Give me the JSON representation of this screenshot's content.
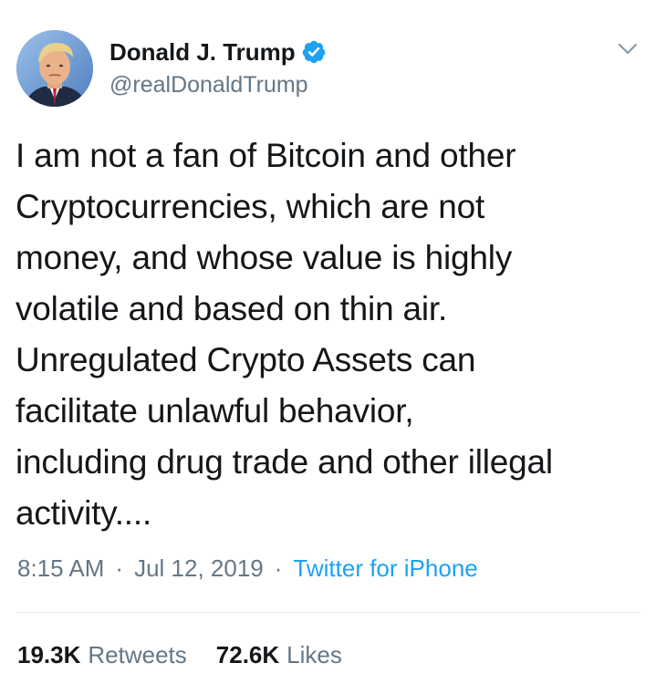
{
  "author": {
    "display_name": "Donald J. Trump",
    "handle": "@realDonaldTrump",
    "verified": true,
    "avatar_icon": "profile-photo"
  },
  "tweet": {
    "text": "I am not a fan of Bitcoin and other\nCryptocurrencies, which are not\nmoney, and whose value is highly\nvolatile and based on thin air.\nUnregulated Crypto Assets can\nfacilitate unlawful behavior,\nincluding drug trade and other illegal\nactivity....",
    "time": "8:15 AM",
    "date": "Jul 12, 2019",
    "separator": "·",
    "source": "Twitter for iPhone"
  },
  "stats": {
    "retweets_count": "19.3K",
    "retweets_label": "Retweets",
    "likes_count": "72.6K",
    "likes_label": "Likes"
  },
  "colors": {
    "text_primary": "#14171a",
    "text_secondary": "#657786",
    "accent": "#1da1f2",
    "divider": "#e1e8ed"
  },
  "icons": {
    "verified": "verified-badge-icon",
    "menu": "chevron-down-icon"
  }
}
